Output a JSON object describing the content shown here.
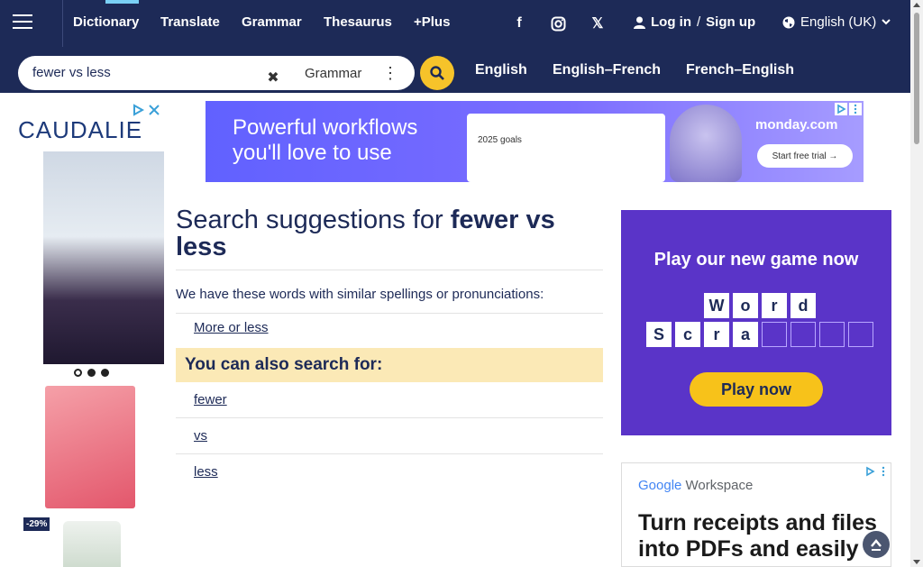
{
  "header": {
    "menu_icon": "hamburger-icon",
    "nav": [
      {
        "label": "Dictionary",
        "active": true
      },
      {
        "label": "Translate"
      },
      {
        "label": "Grammar"
      },
      {
        "label": "Thesaurus"
      },
      {
        "label": "+Plus"
      }
    ],
    "social": {
      "facebook": "f",
      "instagram": "instagram-icon",
      "x": "𝕏"
    },
    "login_label": "Log in",
    "auth_separator": "/",
    "signup_label": "Sign up",
    "language_label": "English (UK)"
  },
  "search": {
    "query": "fewer vs less",
    "dictionary_select": "Grammar",
    "lang_tabs": [
      "English",
      "English–French",
      "French–English"
    ]
  },
  "ads": {
    "left": {
      "brand": "CAUDALIE",
      "discount": "-29%"
    },
    "top_banner": {
      "headline_line1": "Powerful workflows",
      "headline_line2": "you'll love to use",
      "mock_goal": "2025 goals",
      "brand": "monday.com",
      "cta": "Start free trial →"
    },
    "game": {
      "title": "Play our new game now",
      "tiles_row1": [
        "W",
        "o",
        "r",
        "d"
      ],
      "tiles_row2": [
        "S",
        "c",
        "r",
        "a"
      ],
      "cta": "Play now"
    },
    "workspace": {
      "logo_google": "Google",
      "logo_suffix": "Workspace",
      "text_line1": "Turn receipts and files",
      "text_line2": "into PDFs and easily"
    }
  },
  "main": {
    "title_prefix": "Search suggestions for",
    "title_term": "fewer vs less",
    "intro": "We have these words with similar spellings or pronunciations:",
    "suggestions": [
      "More or less"
    ],
    "also_heading": "You can also search for:",
    "also": [
      "fewer",
      "vs",
      "less"
    ]
  },
  "colors": {
    "navy": "#1d2a57",
    "accent_yellow": "#f6c32a",
    "also_bg": "#fbe9b6",
    "active_tab": "#7ad0f5"
  }
}
